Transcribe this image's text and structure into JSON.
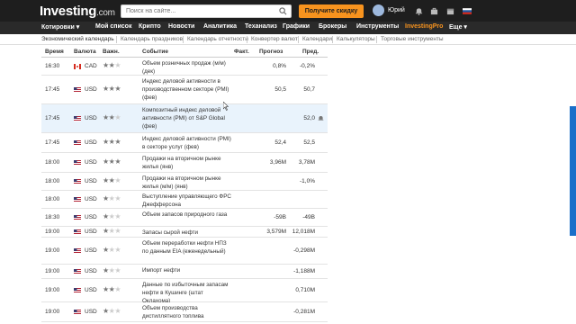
{
  "header": {
    "logo": "Investing",
    "logo_domain": ".com",
    "search_placeholder": "Поиск на сайте...",
    "promo_label": "Получите скидку 40%",
    "user_name": "Юрий"
  },
  "nav": [
    {
      "label": "Котировки ▾"
    },
    {
      "label": "Мой список"
    },
    {
      "label": "Крипто"
    },
    {
      "label": "Новости"
    },
    {
      "label": "Аналитика"
    },
    {
      "label": "Теханализ"
    },
    {
      "label": "Графики"
    },
    {
      "label": "Брокеры"
    },
    {
      "label": "Инструменты"
    },
    {
      "label": "InvestingPro"
    },
    {
      "label": "Еще ▾"
    }
  ],
  "subnav": [
    {
      "label": "Экономический календарь"
    },
    {
      "label": "Календарь праздников"
    },
    {
      "label": "Календарь отчетности"
    },
    {
      "label": "Конвертер валют"
    },
    {
      "label": "Календари"
    },
    {
      "label": "Калькуляторы"
    },
    {
      "label": "Торговые инструменты"
    }
  ],
  "table": {
    "headers": {
      "time": "Время",
      "currency": "Валюта",
      "importance": "Важн.",
      "event": "Событие",
      "actual": "Факт.",
      "forecast": "Прогноз",
      "previous": "Пред."
    },
    "rows": [
      {
        "time": "16:30",
        "flag": "CA",
        "currency": "CAD",
        "stars": 2,
        "event": "Объем розничных продаж (м/м) (дек)",
        "actual": "",
        "forecast": "0,8%",
        "previous": "-0,2%"
      },
      {
        "time": "17:45",
        "flag": "US",
        "currency": "USD",
        "stars": 3,
        "event": "Индекс деловой активности в производственном секторе (PMI) (фев)",
        "actual": "",
        "forecast": "50,5",
        "previous": "50,7"
      },
      {
        "time": "17:45",
        "flag": "US",
        "currency": "USD",
        "stars": 2,
        "event": "Композитный индекс деловой активности (PMI) от S&P Global (фев)",
        "actual": "",
        "forecast": "",
        "previous": "52,0"
      },
      {
        "time": "17:45",
        "flag": "US",
        "currency": "USD",
        "stars": 3,
        "event": "Индекс деловой активности (PMI) в секторе услуг (фев)",
        "actual": "",
        "forecast": "52,4",
        "previous": "52,5"
      },
      {
        "time": "18:00",
        "flag": "US",
        "currency": "USD",
        "stars": 3,
        "event": "Продажи на вторичном рынке жилья (янв)",
        "actual": "",
        "forecast": "3,96M",
        "previous": "3,78M"
      },
      {
        "time": "18:00",
        "flag": "US",
        "currency": "USD",
        "stars": 2,
        "event": "Продажи на вторичном рынке жилья (м/м) (янв)",
        "actual": "",
        "forecast": "",
        "previous": "-1,0%"
      },
      {
        "time": "18:00",
        "flag": "US",
        "currency": "USD",
        "stars": 1,
        "event": "Выступление управляющего ФРС Джефферсона",
        "actual": "",
        "forecast": "",
        "previous": ""
      },
      {
        "time": "18:30",
        "flag": "US",
        "currency": "USD",
        "stars": 1,
        "event": "Объем запасов природного газа",
        "actual": "",
        "forecast": "-59B",
        "previous": "-49B"
      },
      {
        "time": "19:00",
        "flag": "US",
        "currency": "USD",
        "stars": 1,
        "event": "Запасы сырой нефти",
        "actual": "",
        "forecast": "3,579M",
        "previous": "12,018M"
      },
      {
        "time": "19:00",
        "flag": "US",
        "currency": "USD",
        "stars": 1,
        "event": "Объем переработки нефти НПЗ по данным EIA (еженедельный)",
        "actual": "",
        "forecast": "",
        "previous": "-0,298M"
      },
      {
        "time": "19:00",
        "flag": "US",
        "currency": "USD",
        "stars": 1,
        "event": "Импорт нефти",
        "actual": "",
        "forecast": "",
        "previous": "-1,188M"
      },
      {
        "time": "19:00",
        "flag": "US",
        "currency": "USD",
        "stars": 2,
        "event": "Данные по избыточным запасам нефти в Кушинге (штат Оклахома)",
        "actual": "",
        "forecast": "",
        "previous": "0,710M"
      },
      {
        "time": "19:00",
        "flag": "US",
        "currency": "USD",
        "stars": 1,
        "event": "Объем производства дистиллятного топлива",
        "actual": "",
        "forecast": "",
        "previous": "-0,281M"
      }
    ]
  }
}
